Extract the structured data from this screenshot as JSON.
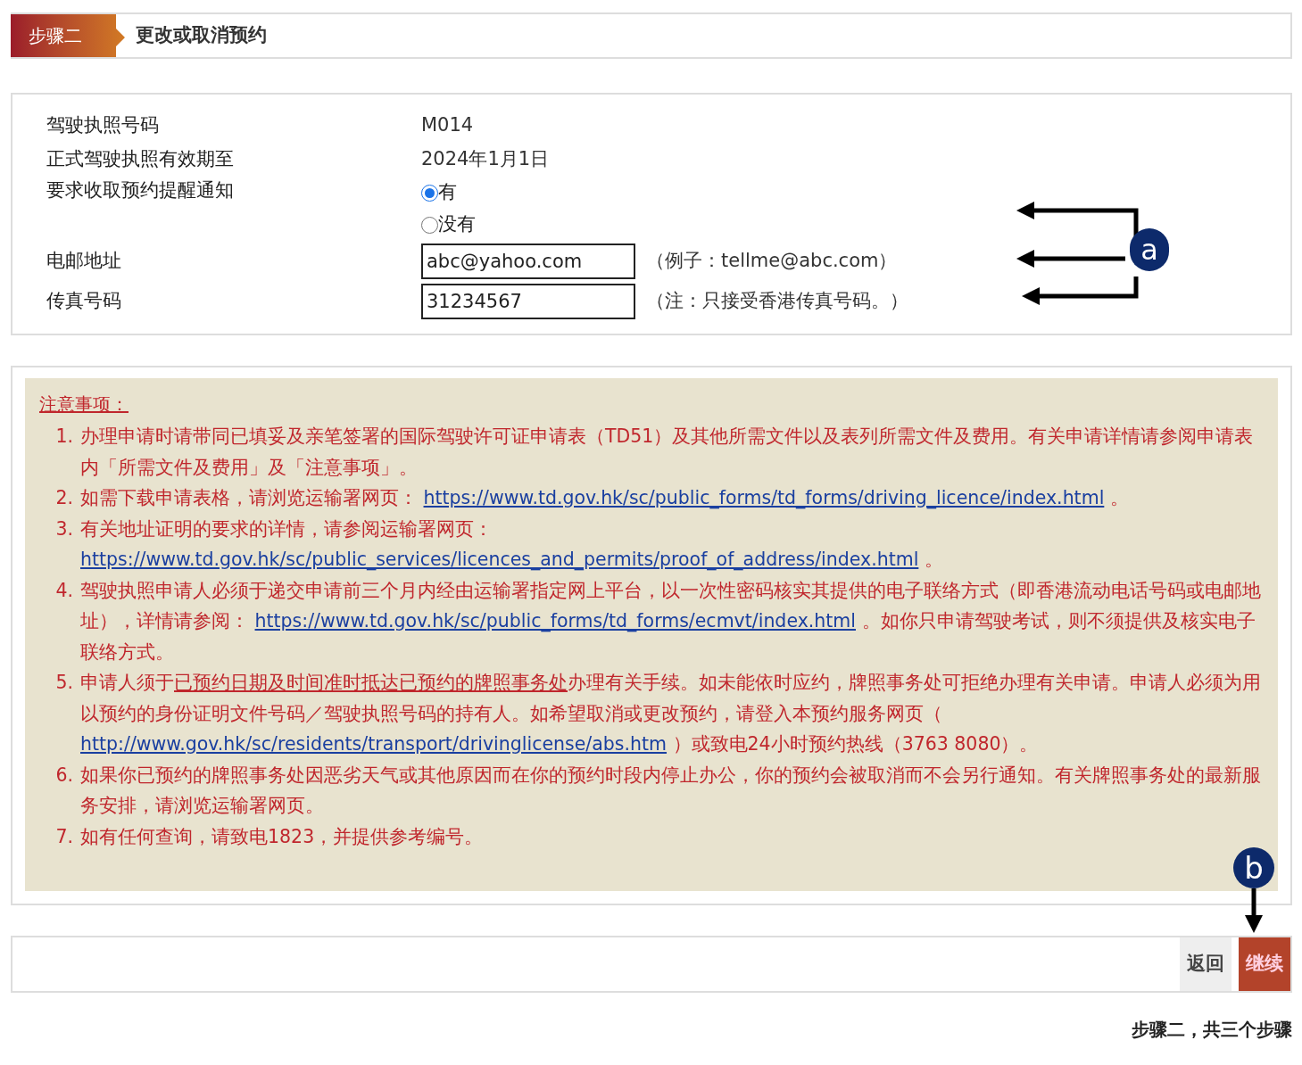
{
  "header": {
    "step": "步骤二",
    "title": "更改或取消预约"
  },
  "form": {
    "rows": [
      {
        "kind": "text",
        "label": "驾驶执照号码",
        "value": "M014"
      },
      {
        "kind": "text",
        "label": "正式驾驶执照有效期至",
        "value": "2024年1月1日"
      },
      {
        "kind": "radio",
        "label": "要求收取预约提醒通知",
        "options": [
          {
            "label": "有",
            "selected": true
          },
          {
            "label": "没有",
            "selected": false
          }
        ]
      },
      {
        "kind": "input",
        "label": "电邮地址",
        "value": "abc@yahoo.com",
        "hint": "（例子：tellme@abc.com）"
      },
      {
        "kind": "input",
        "label": "传真号码",
        "value": "31234567",
        "hint": "（注：只接受香港传真号码。）"
      }
    ],
    "callout": "a"
  },
  "notes": {
    "title": "注意事项：",
    "items": [
      {
        "number": "1.",
        "segments": [
          {
            "kind": "text",
            "text": "办理申请时请带同已填妥及亲笔签署的国际驾驶许可证申请表（TD51）及其他所需文件以及表列所需文件及费用。有关申请详情请参阅申请表内「所需文件及费用」及「注意事项」。"
          }
        ]
      },
      {
        "number": "2.",
        "segments": [
          {
            "kind": "text",
            "text": "如需下载申请表格，请浏览运输署网页： "
          },
          {
            "kind": "link",
            "text": "https://www.td.gov.hk/sc/public_forms/td_forms/driving_licence/index.html"
          },
          {
            "kind": "text",
            "text": " 。"
          }
        ]
      },
      {
        "number": "3.",
        "segments": [
          {
            "kind": "text",
            "text": "有关地址证明的要求的详情，请参阅运输署网页： "
          },
          {
            "kind": "link",
            "text": "https://www.td.gov.hk/sc/public_services/licences_and_permits/proof_of_address/index.html"
          },
          {
            "kind": "text",
            "text": " 。"
          }
        ]
      },
      {
        "number": "4.",
        "segments": [
          {
            "kind": "text",
            "text": "驾驶执照申请人必须于递交申请前三个月内经由运输署指定网上平台，以一次性密码核实其提供的电子联络方式（即香港流动电话号码或电邮地址），详情请参阅： "
          },
          {
            "kind": "link",
            "text": "https://www.td.gov.hk/sc/public_forms/td_forms/ecmvt/index.html"
          },
          {
            "kind": "text",
            "text": " 。如你只申请驾驶考试，则不须提供及核实电子联络方式。"
          }
        ]
      },
      {
        "number": "5.",
        "segments": [
          {
            "kind": "text",
            "text": "申请人须于"
          },
          {
            "kind": "underline",
            "text": "已预约日期及时间准时抵达已预约的牌照事务处"
          },
          {
            "kind": "text",
            "text": "办理有关手续。如未能依时应约，牌照事务处可拒绝办理有关申请。申请人必须为用以预约的身份证明文件号码／驾驶执照号码的持有人。如希望取消或更改预约，请登入本预约服务网页（ "
          },
          {
            "kind": "link",
            "text": "http://www.gov.hk/sc/residents/transport/drivinglicense/abs.htm"
          },
          {
            "kind": "text",
            "text": " ）或致电24小时预约热线（3763 8080）。"
          }
        ]
      },
      {
        "number": "6.",
        "segments": [
          {
            "kind": "text",
            "text": "如果你已预约的牌照事务处因恶劣天气或其他原因而在你的预约时段内停止办公，你的预约会被取消而不会另行通知。有关牌照事务处的最新服务安排，请浏览运输署网页。"
          }
        ]
      },
      {
        "number": "7.",
        "segments": [
          {
            "kind": "text",
            "text": "如有任何查询，请致电1823，并提供参考编号。"
          }
        ]
      }
    ],
    "callout": "b"
  },
  "buttons": [
    {
      "kind": "secondary",
      "label": "返回"
    },
    {
      "kind": "primary",
      "label": "继续"
    }
  ],
  "footer": "步骤二，共三个步骤"
}
